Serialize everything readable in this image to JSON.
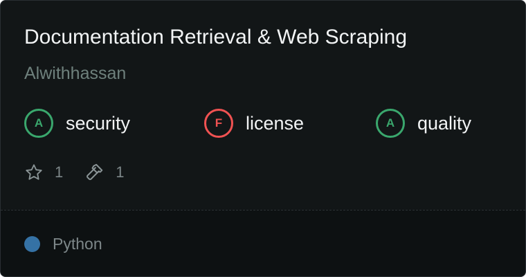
{
  "server": {
    "title": "Documentation Retrieval & Web Scraping",
    "author": "Alwithhassan"
  },
  "grades": [
    {
      "letter": "A",
      "label": "security",
      "status_color": "#3aa76d"
    },
    {
      "letter": "F",
      "label": "license",
      "status_color": "#f05252"
    },
    {
      "letter": "A",
      "label": "quality",
      "status_color": "#3aa76d"
    }
  ],
  "stats": {
    "stars": {
      "icon": "star-icon",
      "count": "1"
    },
    "tools": {
      "icon": "hammer-icon",
      "count": "1"
    }
  },
  "language": {
    "name": "Python",
    "color": "#3572a5"
  }
}
